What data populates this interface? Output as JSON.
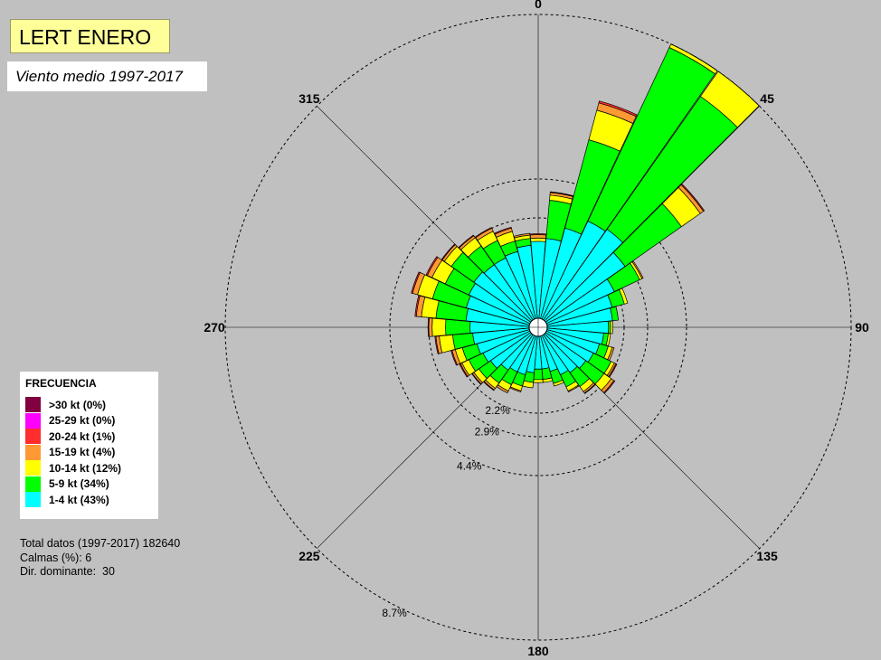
{
  "header": {
    "title": "LERT ENERO",
    "subtitle": "Viento medio 1997-2017"
  },
  "legend": {
    "title": "FRECUENCIA",
    "items": [
      {
        "label": ">30 kt (0%)",
        "color": "#800040"
      },
      {
        "label": "25-29 kt (0%)",
        "color": "#ff00ff"
      },
      {
        "label": "20-24 kt (1%)",
        "color": "#ff2d2d"
      },
      {
        "label": "15-19 kt (4%)",
        "color": "#ff9933"
      },
      {
        "label": "10-14 kt (12%)",
        "color": "#ffff00"
      },
      {
        "label": "5-9 kt (34%)",
        "color": "#00ff00"
      },
      {
        "label": "1-4 kt (43%)",
        "color": "#00ffff"
      }
    ]
  },
  "info": {
    "total": "Total datos (1997-2017) 182640",
    "calms": "Calmas (%): 6",
    "dominant": "Dir. dominante:  30"
  },
  "chart_data": {
    "type": "windrose",
    "directions": [
      0,
      10,
      20,
      30,
      40,
      50,
      60,
      70,
      80,
      90,
      100,
      110,
      120,
      130,
      140,
      150,
      160,
      170,
      180,
      190,
      200,
      210,
      220,
      230,
      240,
      250,
      260,
      270,
      280,
      290,
      300,
      310,
      320,
      330,
      340,
      350
    ],
    "direction_labels": [
      "0",
      "45",
      "90",
      "135",
      "180",
      "225",
      "270",
      "315"
    ],
    "rings": [
      {
        "value": 2.2,
        "label": "2.2%"
      },
      {
        "value": 2.9,
        "label": "2.9%"
      },
      {
        "value": 4.4,
        "label": "4.4%"
      },
      {
        "value": 8.7,
        "label": "8.7%"
      }
    ],
    "series": [
      {
        "name": "1-4 kt",
        "values": [
          2.2,
          2.3,
          2.7,
          3.2,
          3.3,
          2.8,
          2.1,
          1.7,
          1.6,
          1.4,
          1.2,
          1.1,
          1.0,
          0.9,
          0.8,
          0.7,
          0.5,
          0.4,
          0.4,
          0.5,
          0.6,
          0.6,
          0.7,
          0.9,
          1.0,
          1.1,
          1.2,
          1.3,
          1.5,
          1.6,
          1.7,
          1.8,
          1.7,
          1.7,
          1.8,
          2.0
        ]
      },
      {
        "name": "5-9 kt",
        "values": [
          0.0,
          1.3,
          2.9,
          5.4,
          4.6,
          2.3,
          0.9,
          0.6,
          0.3,
          0.1,
          0.2,
          0.4,
          0.9,
          1.0,
          0.7,
          0.5,
          0.4,
          0.3,
          0.3,
          0.3,
          0.4,
          0.5,
          0.6,
          0.6,
          0.7,
          0.7,
          1.0,
          1.1,
          1.2,
          1.3,
          1.0,
          1.0,
          0.9,
          0.8,
          0.5,
          0.3
        ]
      },
      {
        "name": "10-14 kt",
        "values": [
          0.1,
          0.2,
          0.8,
          1.4,
          1.3,
          0.6,
          0.1,
          0.1,
          0.0,
          0.1,
          0.1,
          0.2,
          0.2,
          0.4,
          0.3,
          0.2,
          0.1,
          0.1,
          0.1,
          0.2,
          0.2,
          0.3,
          0.3,
          0.3,
          0.4,
          0.4,
          0.4,
          0.4,
          0.5,
          0.6,
          0.5,
          0.3,
          0.3,
          0.3,
          0.3,
          0.1
        ]
      },
      {
        "name": "15-19 kt",
        "values": [
          0.1,
          0.1,
          0.2,
          0.4,
          0.5,
          0.1,
          0.05,
          0.0,
          0.0,
          0.0,
          0.0,
          0.1,
          0.1,
          0.1,
          0.1,
          0.05,
          0.0,
          0.0,
          0.0,
          0.0,
          0.05,
          0.1,
          0.1,
          0.1,
          0.1,
          0.1,
          0.1,
          0.1,
          0.2,
          0.2,
          0.2,
          0.1,
          0.1,
          0.1,
          0.1,
          0.05
        ]
      },
      {
        "name": "20-24 kt",
        "values": [
          0.03,
          0.03,
          0.05,
          0.08,
          0.12,
          0.03,
          0.0,
          0.0,
          0.0,
          0.0,
          0.0,
          0.0,
          0.03,
          0.03,
          0.03,
          0.0,
          0.0,
          0.0,
          0.0,
          0.0,
          0.0,
          0.0,
          0.03,
          0.03,
          0.03,
          0.03,
          0.03,
          0.03,
          0.05,
          0.05,
          0.05,
          0.03,
          0.03,
          0.03,
          0.03,
          0.0
        ]
      },
      {
        "name": "25-29 kt",
        "values": [
          0,
          0,
          0,
          0,
          0,
          0,
          0,
          0,
          0,
          0,
          0,
          0,
          0,
          0,
          0,
          0,
          0,
          0,
          0,
          0,
          0,
          0,
          0,
          0,
          0,
          0,
          0,
          0,
          0,
          0,
          0,
          0,
          0,
          0,
          0,
          0
        ]
      },
      {
        "name": ">30 kt",
        "values": [
          0,
          0,
          0,
          0,
          0,
          0,
          0,
          0,
          0,
          0,
          0,
          0,
          0,
          0,
          0,
          0,
          0,
          0,
          0,
          0,
          0,
          0,
          0,
          0,
          0,
          0,
          0,
          0,
          0,
          0,
          0,
          0,
          0,
          0,
          0,
          0
        ]
      }
    ],
    "calm_percent": 6,
    "dominant_direction": 30
  }
}
